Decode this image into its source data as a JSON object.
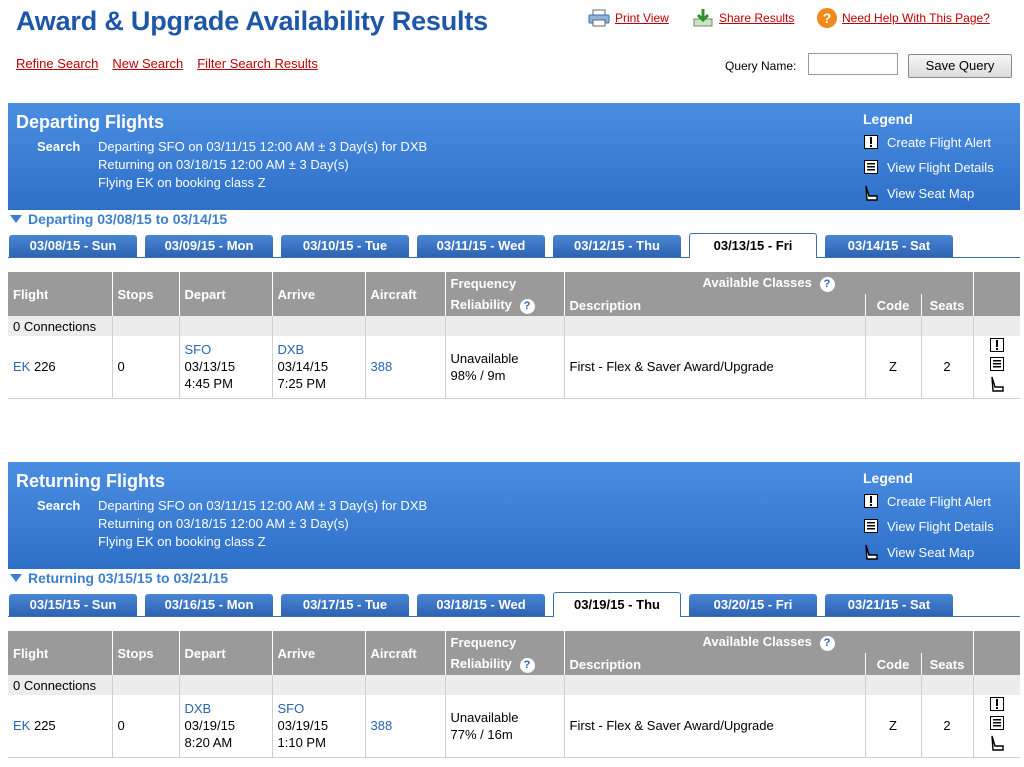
{
  "header": {
    "title": "Award & Upgrade Availability Results",
    "print_view": "Print View",
    "share_results": "Share Results",
    "need_help": "Need Help With This Page?",
    "refine_search": "Refine Search",
    "new_search": "New Search",
    "filter_results": "Filter Search Results",
    "query_name_label": "Query Name:",
    "query_name_value": "",
    "save_query": "Save Query"
  },
  "legend": {
    "title": "Legend",
    "items": [
      "Create Flight Alert",
      "View Flight Details",
      "View Seat Map"
    ]
  },
  "table_headers": {
    "flight": "Flight",
    "stops": "Stops",
    "depart": "Depart",
    "arrive": "Arrive",
    "aircraft": "Aircraft",
    "frequency": "Frequency",
    "reliability": "Reliability",
    "available_classes": "Available Classes",
    "description": "Description",
    "code": "Code",
    "seats": "Seats"
  },
  "departing": {
    "heading": "Departing Flights",
    "search_label": "Search",
    "search_lines": [
      "Departing SFO on 03/11/15 12:00 AM ± 3 Day(s) for DXB",
      "Returning on 03/18/15 12:00 AM ± 3 Day(s)",
      "Flying EK on booking class Z"
    ],
    "range": "Departing 03/08/15 to 03/14/15",
    "tabs": [
      "03/08/15 - Sun",
      "03/09/15 - Mon",
      "03/10/15 - Tue",
      "03/11/15 - Wed",
      "03/12/15 - Thu",
      "03/13/15 - Fri",
      "03/14/15 - Sat"
    ],
    "active_tab": 5,
    "connections": "0 Connections",
    "flight": {
      "airline": "EK",
      "number": "226",
      "stops": "0",
      "depart_airport": "SFO",
      "depart_date": "03/13/15",
      "depart_time": "4:45 PM",
      "arrive_airport": "DXB",
      "arrive_date": "03/14/15",
      "arrive_time": "7:25 PM",
      "aircraft": "388",
      "frequency": "Unavailable",
      "reliability": "98% / 9m",
      "description": "First - Flex & Saver Award/Upgrade",
      "code": "Z",
      "seats": "2"
    }
  },
  "returning": {
    "heading": "Returning Flights",
    "search_label": "Search",
    "search_lines": [
      "Departing SFO on 03/11/15 12:00 AM ± 3 Day(s) for DXB",
      "Returning on 03/18/15 12:00 AM ± 3 Day(s)",
      "Flying EK on booking class Z"
    ],
    "range": "Returning 03/15/15 to 03/21/15",
    "tabs": [
      "03/15/15 - Sun",
      "03/16/15 - Mon",
      "03/17/15 - Tue",
      "03/18/15 - Wed",
      "03/19/15 - Thu",
      "03/20/15 - Fri",
      "03/21/15 - Sat"
    ],
    "active_tab": 4,
    "connections": "0 Connections",
    "flight": {
      "airline": "EK",
      "number": "225",
      "stops": "0",
      "depart_airport": "DXB",
      "depart_date": "03/19/15",
      "depart_time": "8:20 AM",
      "arrive_airport": "SFO",
      "arrive_date": "03/19/15",
      "arrive_time": "1:10 PM",
      "aircraft": "388",
      "frequency": "Unavailable",
      "reliability": "77% / 16m",
      "description": "First - Flex & Saver Award/Upgrade",
      "code": "Z",
      "seats": "2"
    }
  }
}
